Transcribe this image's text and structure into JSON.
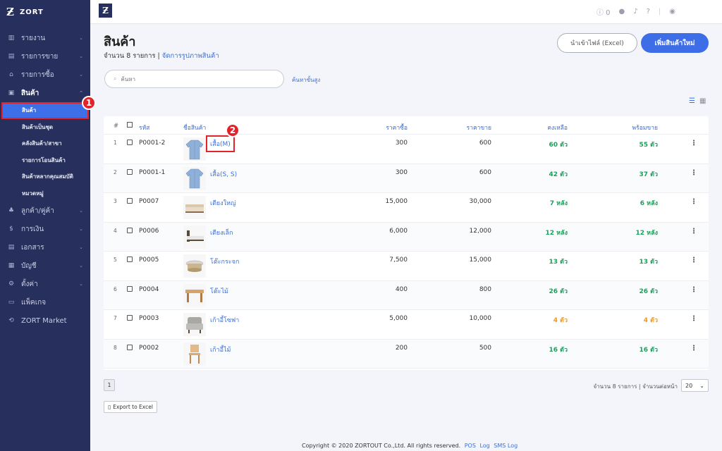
{
  "brand": {
    "mark": "Ƶ",
    "name": "ZORT"
  },
  "nav": [
    {
      "label": "รายงาน",
      "icon": "chart-icon",
      "glyph": "▥",
      "chev": "⌄"
    },
    {
      "label": "รายการขาย",
      "icon": "clipboard-icon",
      "glyph": "▤",
      "chev": "⌄"
    },
    {
      "label": "รายการซื้อ",
      "icon": "basket-icon",
      "glyph": "⌂",
      "chev": "⌄"
    },
    {
      "label": "สินค้า",
      "icon": "box-icon",
      "glyph": "▣",
      "chev": "⌃"
    }
  ],
  "subnav": [
    "สินค้า",
    "สินค้าเป็นชุด",
    "คลังสินค้า/สาขา",
    "รายการโอนสินค้า",
    "สินค้าหลากคุณสมบัติ",
    "หมวดหมู่"
  ],
  "nav2": [
    {
      "label": "ลูกค้า/คู่ค้า",
      "icon": "users-icon",
      "glyph": "♣",
      "chev": "⌄"
    },
    {
      "label": "การเงิน",
      "icon": "money-icon",
      "glyph": "$",
      "chev": "⌄"
    },
    {
      "label": "เอกสาร",
      "icon": "document-icon",
      "glyph": "▤",
      "chev": "⌄"
    },
    {
      "label": "บัญชี",
      "icon": "ledger-icon",
      "glyph": "▦",
      "chev": "⌄"
    },
    {
      "label": "ตั้งค่า",
      "icon": "gear-icon",
      "glyph": "⚙",
      "chev": "⌄"
    },
    {
      "label": "แพ็คเกจ",
      "icon": "package-icon",
      "glyph": "▭",
      "chev": ""
    },
    {
      "label": "ZORT Market",
      "icon": "market-icon",
      "glyph": "⟲",
      "chev": ""
    }
  ],
  "annotations": {
    "one": "1",
    "two": "2"
  },
  "topbar": {
    "logo": "Ƶ",
    "count": "0"
  },
  "page": {
    "title": "สินค้า",
    "subtitle_prefix": "จำนวน 8 รายการ | ",
    "subtitle_link": "จัดการรูปภาพสินค้า",
    "import_label": "นำเข้าไฟล์ (Excel)",
    "add_label": "เพิ่มสินค้าใหม่",
    "search_placeholder": "ค้นหา",
    "adv_search": "ค้นหาขั้นสูง"
  },
  "table": {
    "headers": {
      "num": "#",
      "code": "รหัส",
      "name": "ชื่อสินค้า",
      "buy": "ราคาซื้อ",
      "sell": "ราคาขาย",
      "stock": "คงเหลือ",
      "avail": "พร้อมขาย"
    },
    "rows": [
      {
        "num": "1",
        "code": "P0001-2",
        "name": "เสื้อ(M)",
        "buy": "300",
        "sell": "600",
        "stock": "60 ตัว",
        "avail": "55 ตัว",
        "thumb": "shirt-thumb",
        "warn": false
      },
      {
        "num": "2",
        "code": "P0001-1",
        "name": "เสื้อ(S, S)",
        "buy": "300",
        "sell": "600",
        "stock": "42 ตัว",
        "avail": "37 ตัว",
        "thumb": "shirt-thumb",
        "warn": false
      },
      {
        "num": "3",
        "code": "P0007",
        "name": "เตียงใหญ่",
        "buy": "15,000",
        "sell": "30,000",
        "stock": "7 หลัง",
        "avail": "6 หลัง",
        "thumb": "bed-thumb",
        "warn": false
      },
      {
        "num": "4",
        "code": "P0006",
        "name": "เตียงเล็ก",
        "buy": "6,000",
        "sell": "12,000",
        "stock": "12 หลัง",
        "avail": "12 หลัง",
        "thumb": "small-bed-thumb",
        "warn": false
      },
      {
        "num": "5",
        "code": "P0005",
        "name": "โต๊ะกระจก",
        "buy": "7,500",
        "sell": "15,000",
        "stock": "13 ตัว",
        "avail": "13 ตัว",
        "thumb": "glass-table-thumb",
        "warn": false
      },
      {
        "num": "6",
        "code": "P0004",
        "name": "โต๊ะไม้",
        "buy": "400",
        "sell": "800",
        "stock": "26 ตัว",
        "avail": "26 ตัว",
        "thumb": "wood-table-thumb",
        "warn": false
      },
      {
        "num": "7",
        "code": "P0003",
        "name": "เก้าอี้โซฟา",
        "buy": "5,000",
        "sell": "10,000",
        "stock": "4 ตัว",
        "avail": "4 ตัว",
        "thumb": "sofa-chair-thumb",
        "warn": true
      },
      {
        "num": "8",
        "code": "P0002",
        "name": "เก้าอี้ไม้",
        "buy": "200",
        "sell": "500",
        "stock": "16 ตัว",
        "avail": "16 ตัว",
        "thumb": "wood-chair-thumb",
        "warn": false
      }
    ]
  },
  "pager": {
    "page": "1",
    "info": "จำนวน 8 รายการ | จำนวนต่อหน้า",
    "per_page": "20"
  },
  "export_label": "Export to Excel",
  "footer": {
    "copyright": "Copyright © 2020 ZORTOUT Co.,Ltd. All rights reserved.",
    "links": [
      "POS",
      "Log",
      "SMS Log"
    ]
  },
  "colors": {
    "sidebar": "#27305c",
    "accent": "#3d6ee8",
    "stock_ok": "#1d9e5c",
    "stock_low": "#e89a2a",
    "annotation": "#e2232a"
  }
}
